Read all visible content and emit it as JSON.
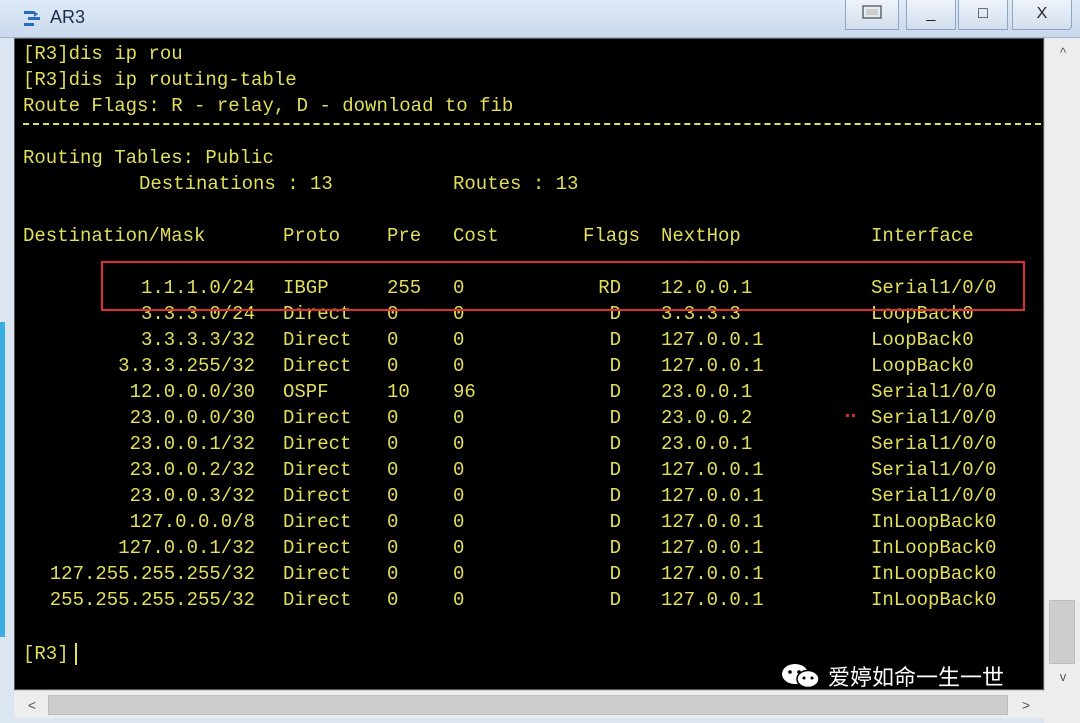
{
  "window": {
    "title": "AR3",
    "controls": {
      "restore_icon": "restore-icon",
      "minimize": "_",
      "maximize": "□",
      "close": "X"
    }
  },
  "terminal": {
    "lines": [
      "[R3]dis ip rou",
      "[R3]dis ip routing-table",
      "Route Flags: R - relay, D - download to fib"
    ],
    "section_title": "Routing Tables: Public",
    "destinations_label": "Destinations : 13",
    "routes_label": "Routes : 13",
    "headers": {
      "destination": "Destination/Mask",
      "proto": "Proto",
      "pre": "Pre",
      "cost": "Cost",
      "flags": "Flags",
      "nexthop": "NextHop",
      "interface": "Interface"
    },
    "rows": [
      {
        "dest": "1.1.1.0/24",
        "proto": "IBGP",
        "pre": "255",
        "cost": "0",
        "flags": "RD",
        "nexthop": "12.0.0.1",
        "iface": "Serial1/0/0"
      },
      {
        "dest": "3.3.3.0/24",
        "proto": "Direct",
        "pre": "0",
        "cost": "0",
        "flags": "D",
        "nexthop": "3.3.3.3",
        "iface": "LoopBack0"
      },
      {
        "dest": "3.3.3.3/32",
        "proto": "Direct",
        "pre": "0",
        "cost": "0",
        "flags": "D",
        "nexthop": "127.0.0.1",
        "iface": "LoopBack0"
      },
      {
        "dest": "3.3.3.255/32",
        "proto": "Direct",
        "pre": "0",
        "cost": "0",
        "flags": "D",
        "nexthop": "127.0.0.1",
        "iface": "LoopBack0"
      },
      {
        "dest": "12.0.0.0/30",
        "proto": "OSPF",
        "pre": "10",
        "cost": "96",
        "flags": "D",
        "nexthop": "23.0.0.1",
        "iface": "Serial1/0/0"
      },
      {
        "dest": "23.0.0.0/30",
        "proto": "Direct",
        "pre": "0",
        "cost": "0",
        "flags": "D",
        "nexthop": "23.0.0.2",
        "iface": "Serial1/0/0"
      },
      {
        "dest": "23.0.0.1/32",
        "proto": "Direct",
        "pre": "0",
        "cost": "0",
        "flags": "D",
        "nexthop": "23.0.0.1",
        "iface": "Serial1/0/0"
      },
      {
        "dest": "23.0.0.2/32",
        "proto": "Direct",
        "pre": "0",
        "cost": "0",
        "flags": "D",
        "nexthop": "127.0.0.1",
        "iface": "Serial1/0/0"
      },
      {
        "dest": "23.0.0.3/32",
        "proto": "Direct",
        "pre": "0",
        "cost": "0",
        "flags": "D",
        "nexthop": "127.0.0.1",
        "iface": "Serial1/0/0"
      },
      {
        "dest": "127.0.0.0/8",
        "proto": "Direct",
        "pre": "0",
        "cost": "0",
        "flags": "D",
        "nexthop": "127.0.0.1",
        "iface": "InLoopBack0"
      },
      {
        "dest": "127.0.0.1/32",
        "proto": "Direct",
        "pre": "0",
        "cost": "0",
        "flags": "D",
        "nexthop": "127.0.0.1",
        "iface": "InLoopBack0"
      },
      {
        "dest": "127.255.255.255/32",
        "proto": "Direct",
        "pre": "0",
        "cost": "0",
        "flags": "D",
        "nexthop": "127.0.0.1",
        "iface": "InLoopBack0"
      },
      {
        "dest": "255.255.255.255/32",
        "proto": "Direct",
        "pre": "0",
        "cost": "0",
        "flags": "D",
        "nexthop": "127.0.0.1",
        "iface": "InLoopBack0"
      }
    ],
    "prompt": "[R3]",
    "text_color": "#e2df5c",
    "background_color": "#000000",
    "highlight_color": "#e0302c"
  },
  "watermark": {
    "icon": "wechat-icon",
    "text": "爱婷如命一生一世"
  },
  "scrollbars": {
    "up_arrow": "^",
    "down_arrow": "v",
    "left_arrow": "<",
    "right_arrow": ">"
  }
}
